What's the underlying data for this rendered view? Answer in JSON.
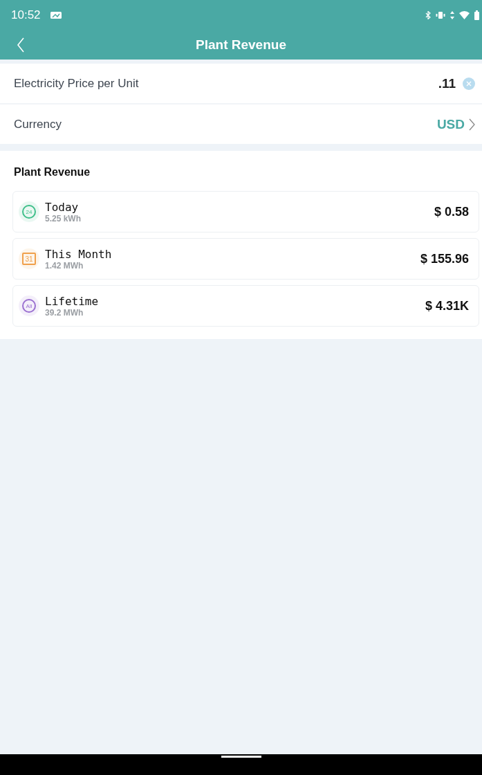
{
  "status_bar": {
    "time": "10:52"
  },
  "header": {
    "title": "Plant Revenue"
  },
  "settings": [
    {
      "kind": "input",
      "label": "Electricity Price per Unit",
      "value": ".11"
    },
    {
      "kind": "select",
      "label": "Currency",
      "value": "USD"
    }
  ],
  "revenue": {
    "title": "Plant Revenue",
    "items": [
      {
        "kind": "day",
        "icon_text": "24",
        "color": "#3fbf8a",
        "title": "Today",
        "energy": "5.25 kWh",
        "amount": "$ 0.58"
      },
      {
        "kind": "month",
        "icon_text": "31",
        "color": "#f0a04b",
        "title": "This Month",
        "energy": "1.42 MWh",
        "amount": "$ 155.96"
      },
      {
        "kind": "all",
        "icon_text": "All",
        "color": "#9a6fd0",
        "title": "Lifetime",
        "energy": "39.2 MWh",
        "amount": "$ 4.31K"
      }
    ]
  }
}
